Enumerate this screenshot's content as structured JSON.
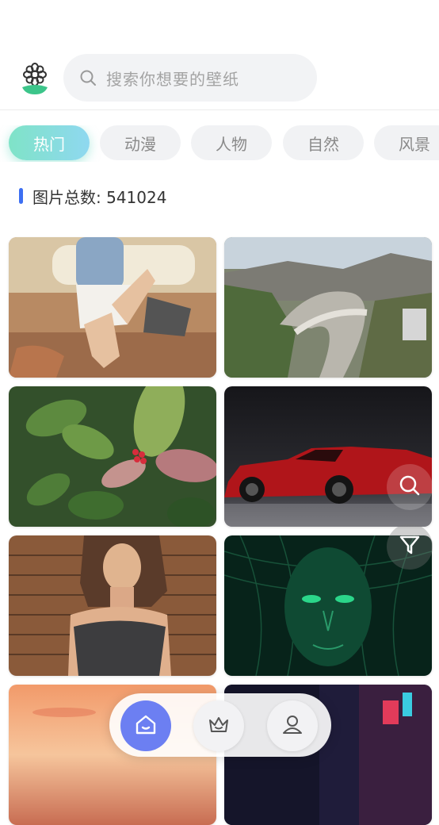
{
  "search": {
    "placeholder": "搜索你想要的壁纸"
  },
  "categories": [
    {
      "label": "热门",
      "active": true
    },
    {
      "label": "动漫",
      "active": false
    },
    {
      "label": "人物",
      "active": false
    },
    {
      "label": "自然",
      "active": false
    },
    {
      "label": "风景",
      "active": false
    }
  ],
  "stats": {
    "label": "图片总数: 541024"
  },
  "wallpapers": [
    {
      "subject": "woman-seated-on-sofa"
    },
    {
      "subject": "mountain-highway-interchange"
    },
    {
      "subject": "green-leaves-red-berries"
    },
    {
      "subject": "red-sports-car"
    },
    {
      "subject": "woman-brick-wall"
    },
    {
      "subject": "green-digital-face"
    },
    {
      "subject": "sunset-sky"
    },
    {
      "subject": "neon-city"
    }
  ],
  "floating": {
    "search_icon": "search-icon",
    "filter_icon": "filter-icon"
  },
  "nav": {
    "items": [
      "home-icon",
      "crown-icon",
      "user-icon"
    ]
  },
  "colors": {
    "accent": "#6c7ff2",
    "active_tab_start": "#7fe3c7",
    "active_tab_end": "#8fd8f0",
    "count_bar": "#3d6ff2"
  }
}
